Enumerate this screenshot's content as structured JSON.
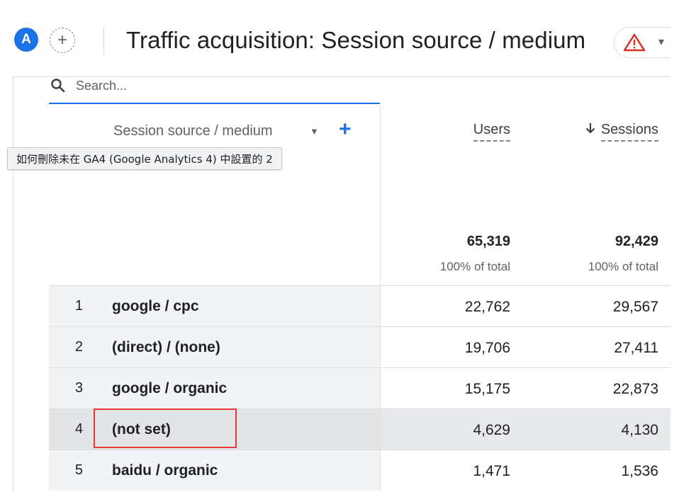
{
  "header": {
    "avatar_letter": "A",
    "add_compare_symbol": "+",
    "title": "Traffic acquisition: Session source / medium",
    "warning_icon": "warning-triangle-icon",
    "dropdown_icon": "chevron-down-icon"
  },
  "search": {
    "placeholder": "Search...",
    "icon": "search-icon"
  },
  "table": {
    "dimension_header": "Session source / medium",
    "add_dimension_symbol": "+",
    "columns": [
      {
        "label": "Users",
        "sorted": false
      },
      {
        "label": "Sessions",
        "sorted": true,
        "sort_direction": "descending"
      }
    ],
    "totals": {
      "users": "65,319",
      "users_pct": "100% of total",
      "sessions": "92,429",
      "sessions_pct": "100% of total"
    },
    "rows": [
      {
        "index": "1",
        "dimension": "google / cpc",
        "users": "22,762",
        "sessions": "29,567"
      },
      {
        "index": "2",
        "dimension": "(direct) / (none)",
        "users": "19,706",
        "sessions": "27,411"
      },
      {
        "index": "3",
        "dimension": "google / organic",
        "users": "15,175",
        "sessions": "22,873"
      },
      {
        "index": "4",
        "dimension": "(not set)",
        "users": "4,629",
        "sessions": "4,130",
        "highlighted": true
      },
      {
        "index": "5",
        "dimension": "baidu / organic",
        "users": "1,471",
        "sessions": "1,536"
      }
    ]
  },
  "tooltip": {
    "text": "如何刪除未在 GA4 (Google Analytics 4) 中設置的 2"
  },
  "colors": {
    "accent": "#1a73e8",
    "highlight_border": "#e53935",
    "warning": "#d93025"
  }
}
